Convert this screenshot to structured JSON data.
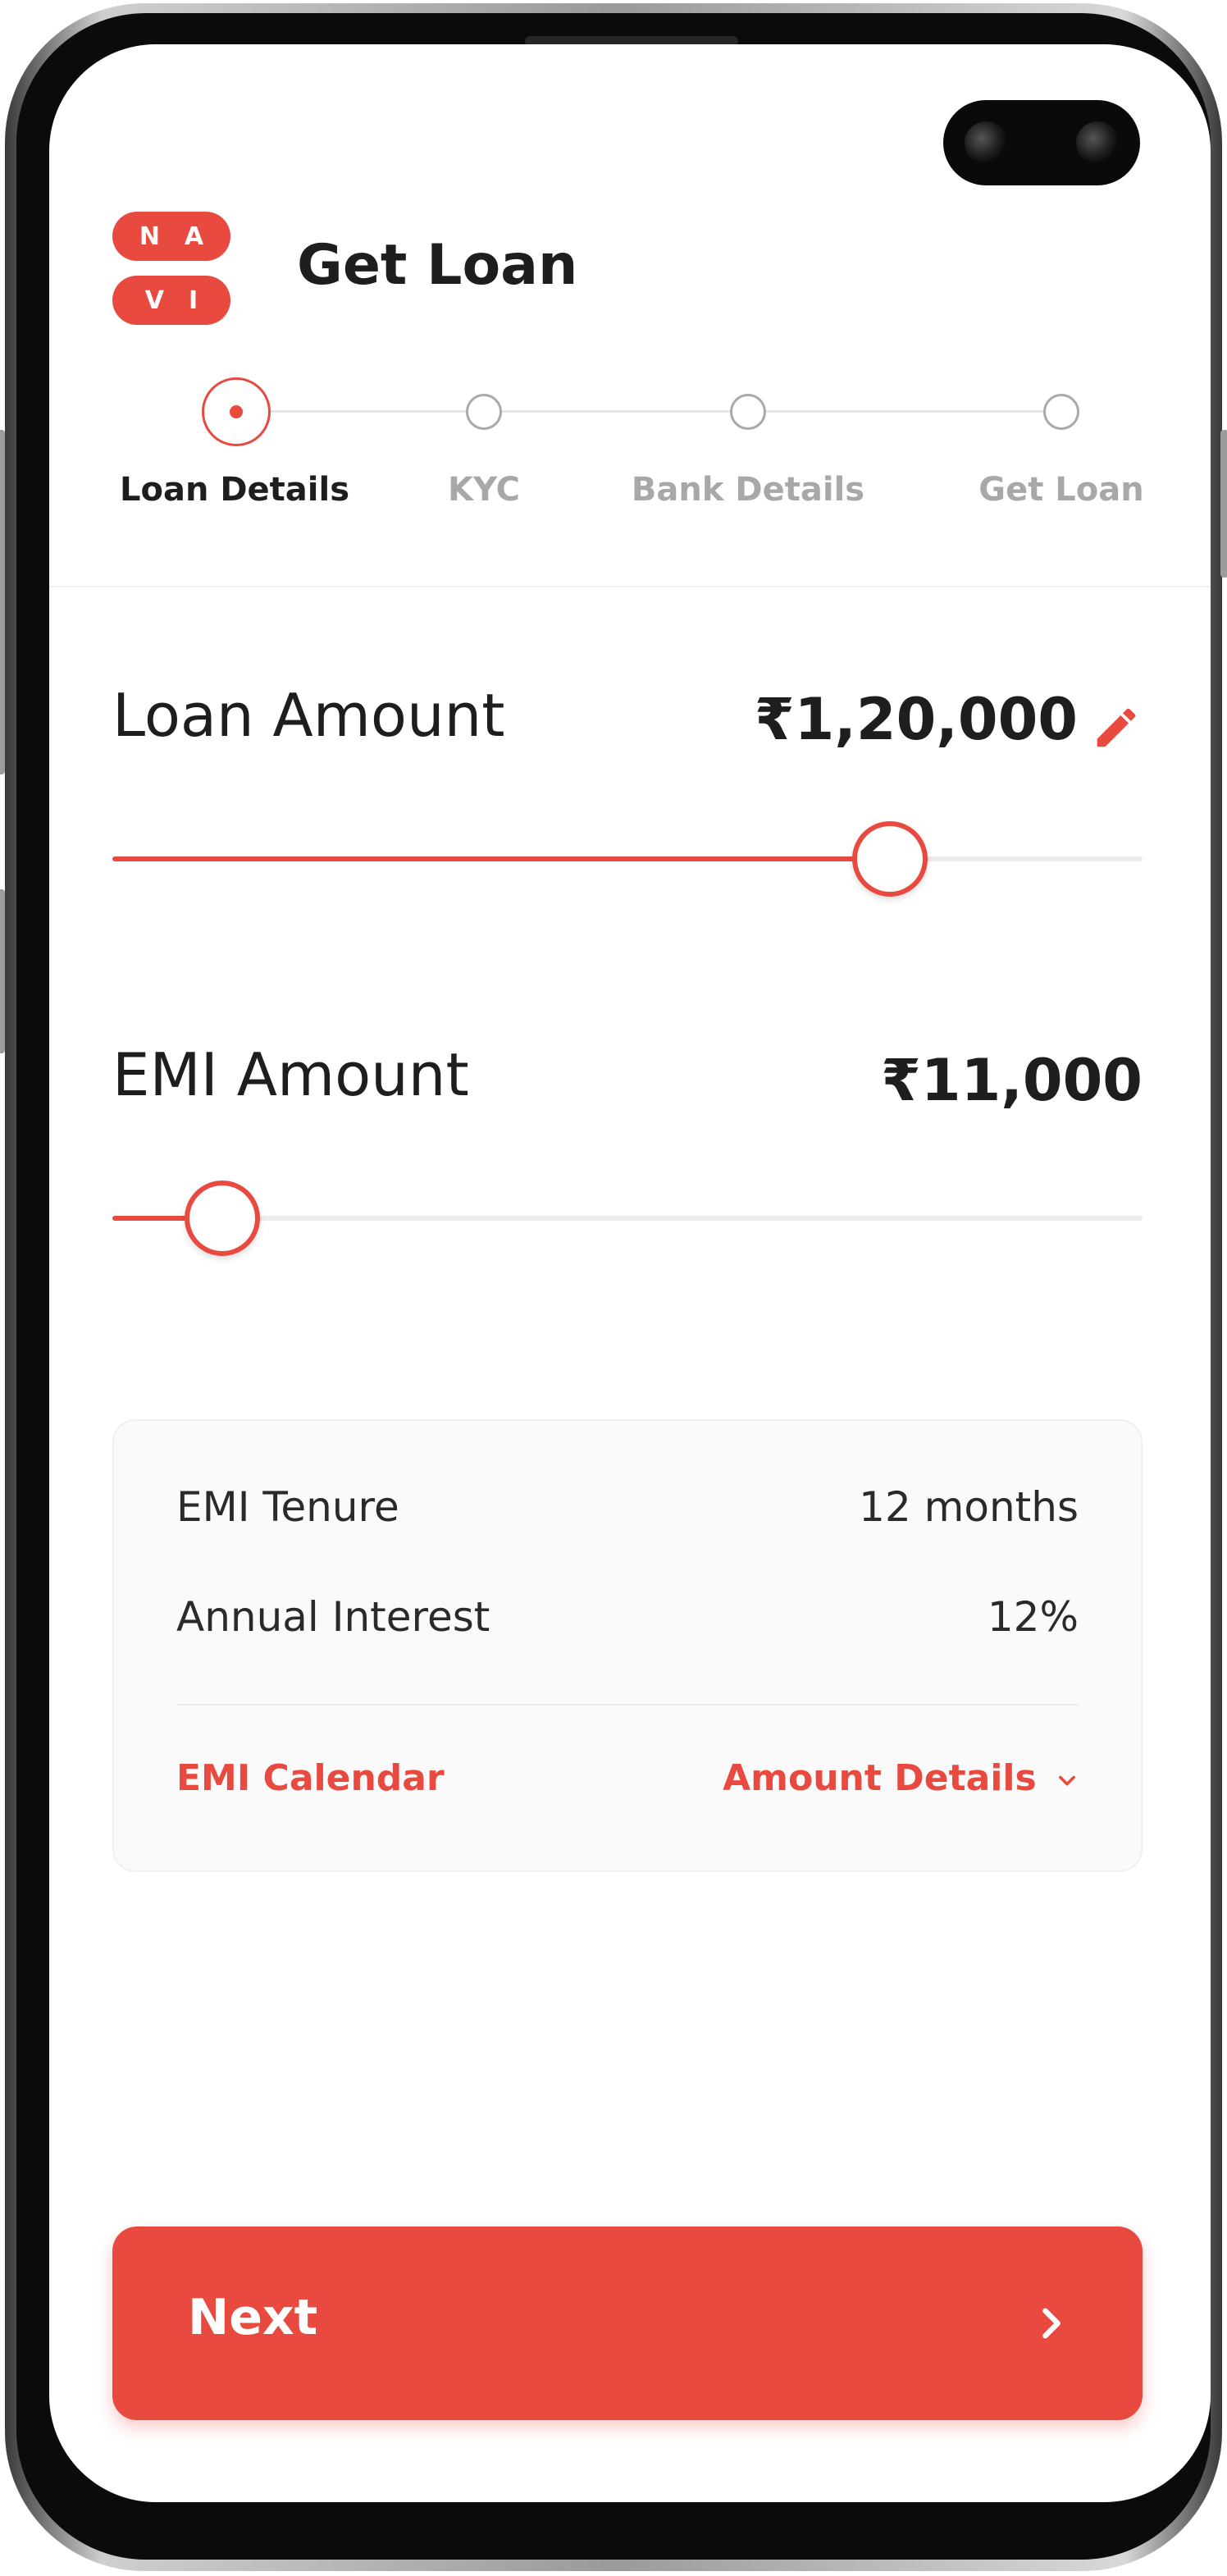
{
  "header": {
    "logo_text_top": "NA",
    "logo_text_bottom": "VI",
    "title": "Get Loan"
  },
  "stepper": {
    "steps": [
      {
        "label": "Loan Details",
        "active": true
      },
      {
        "label": "KYC",
        "active": false
      },
      {
        "label": "Bank Details",
        "active": false
      },
      {
        "label": "Get Loan",
        "active": false
      }
    ]
  },
  "loan_amount": {
    "label": "Loan Amount",
    "value": "₹1,20,000",
    "slider_fraction": 0.755
  },
  "emi_amount": {
    "label": "EMI Amount",
    "value": "₹11,000",
    "slider_fraction": 0.107
  },
  "summary": {
    "rows": [
      {
        "label": "EMI Tenure",
        "value": "12 months"
      },
      {
        "label": "Annual Interest",
        "value": "12%"
      }
    ],
    "emi_calendar_link": "EMI Calendar",
    "amount_details_link": "Amount Details"
  },
  "next_button": {
    "label": "Next"
  },
  "colors": {
    "accent": "#e84a40",
    "text": "#1e1e1e",
    "muted": "#a8a8a8"
  }
}
